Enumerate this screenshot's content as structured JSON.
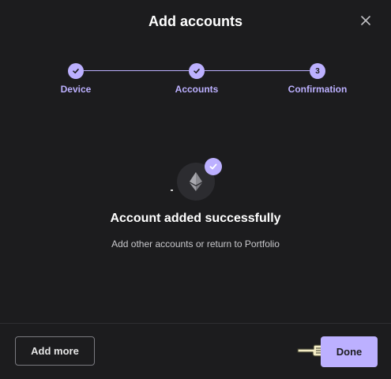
{
  "dialog": {
    "title": "Add accounts",
    "close_icon": "close-icon"
  },
  "stepper": {
    "steps": [
      {
        "label": "Device",
        "state": "complete",
        "marker": "check-icon"
      },
      {
        "label": "Accounts",
        "state": "complete",
        "marker": "check-icon"
      },
      {
        "label": "Confirmation",
        "state": "current",
        "marker": "3"
      }
    ]
  },
  "success": {
    "coin_icon": "ethereum-icon",
    "badge_icon": "check-icon",
    "title": "Account added successfully",
    "subtitle": "Add other accounts or return to Portfolio"
  },
  "footer": {
    "secondary_label": "Add more",
    "primary_label": "Done"
  },
  "colors": {
    "background": "#1c1c1e",
    "accent": "#bcb0ff",
    "text": "#ffffff",
    "muted_text": "#c8c8cc"
  }
}
